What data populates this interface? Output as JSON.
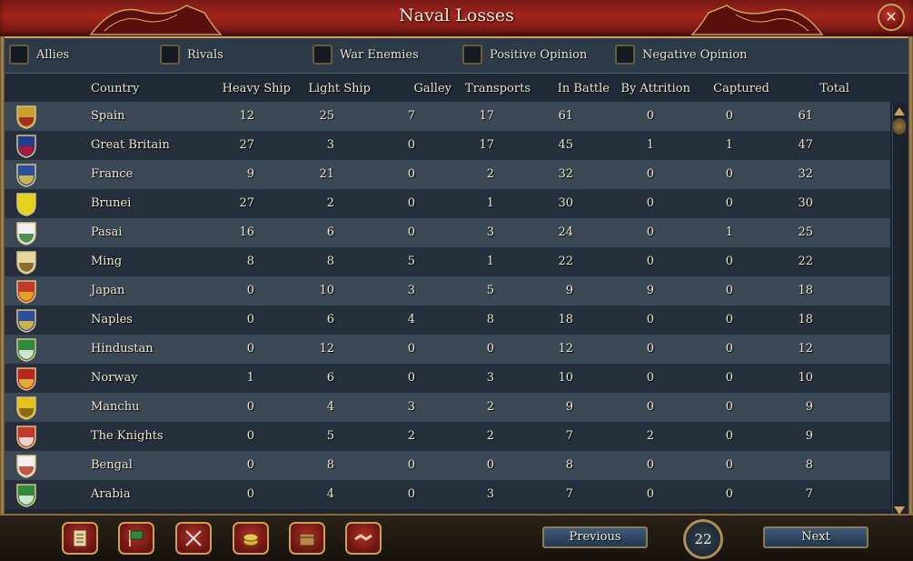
{
  "window": {
    "title": "Naval Losses",
    "close_icon": "close-icon"
  },
  "filters": [
    {
      "label": "Allies",
      "checked": false
    },
    {
      "label": "Rivals",
      "checked": false
    },
    {
      "label": "War Enemies",
      "checked": false
    },
    {
      "label": "Positive Opinion",
      "checked": false
    },
    {
      "label": "Negative Opinion",
      "checked": false
    }
  ],
  "table": {
    "columns": [
      "Country",
      "Heavy Ship",
      "Light Ship",
      "Galley",
      "Transports",
      "In Battle",
      "By Attrition",
      "Captured",
      "Total"
    ],
    "rows": [
      {
        "country": "Spain",
        "flag": "spain-flag-icon",
        "colors": [
          "#c8a12b",
          "#9b1c1c"
        ],
        "values": [
          "12",
          "25",
          "7",
          "17",
          "61",
          "0",
          "0",
          "61"
        ]
      },
      {
        "country": "Great Britain",
        "flag": "great-britain-flag-icon",
        "colors": [
          "#1f3f8c",
          "#c8102e"
        ],
        "values": [
          "27",
          "3",
          "0",
          "17",
          "45",
          "1",
          "1",
          "47"
        ]
      },
      {
        "country": "France",
        "flag": "france-flag-icon",
        "colors": [
          "#2d4fa0",
          "#e6c63d"
        ],
        "values": [
          "9",
          "21",
          "0",
          "2",
          "32",
          "0",
          "0",
          "32"
        ]
      },
      {
        "country": "Brunei",
        "flag": "brunei-flag-icon",
        "colors": [
          "#e3d21c",
          "#e3d21c"
        ],
        "values": [
          "27",
          "2",
          "0",
          "1",
          "30",
          "0",
          "0",
          "30"
        ]
      },
      {
        "country": "Pasai",
        "flag": "pasai-flag-icon",
        "colors": [
          "#f0f0f0",
          "#2e7d32"
        ],
        "values": [
          "16",
          "6",
          "0",
          "3",
          "24",
          "0",
          "1",
          "25"
        ]
      },
      {
        "country": "Ming",
        "flag": "ming-flag-icon",
        "colors": [
          "#e8d7a0",
          "#7a5a20"
        ],
        "values": [
          "8",
          "8",
          "5",
          "1",
          "22",
          "0",
          "0",
          "22"
        ]
      },
      {
        "country": "Japan",
        "flag": "japan-flag-icon",
        "colors": [
          "#c0392b",
          "#e6b422"
        ],
        "values": [
          "0",
          "10",
          "3",
          "5",
          "9",
          "9",
          "0",
          "18"
        ]
      },
      {
        "country": "Naples",
        "flag": "naples-flag-icon",
        "colors": [
          "#2d4fa0",
          "#e6c63d"
        ],
        "values": [
          "0",
          "6",
          "4",
          "8",
          "18",
          "0",
          "0",
          "18"
        ]
      },
      {
        "country": "Hindustan",
        "flag": "hindustan-flag-icon",
        "colors": [
          "#2e8b3a",
          "#f0f0f0"
        ],
        "values": [
          "0",
          "12",
          "0",
          "0",
          "12",
          "0",
          "0",
          "12"
        ]
      },
      {
        "country": "Norway",
        "flag": "norway-flag-icon",
        "colors": [
          "#b5281f",
          "#e6c63d"
        ],
        "values": [
          "1",
          "6",
          "0",
          "3",
          "10",
          "0",
          "0",
          "10"
        ]
      },
      {
        "country": "Manchu",
        "flag": "manchu-flag-icon",
        "colors": [
          "#e3c21c",
          "#7a5a10"
        ],
        "values": [
          "0",
          "4",
          "3",
          "2",
          "9",
          "0",
          "0",
          "9"
        ]
      },
      {
        "country": "The Knights",
        "flag": "the-knights-flag-icon",
        "colors": [
          "#c0392b",
          "#f0f0f0"
        ],
        "values": [
          "0",
          "5",
          "2",
          "2",
          "7",
          "2",
          "0",
          "9"
        ]
      },
      {
        "country": "Bengal",
        "flag": "bengal-flag-icon",
        "colors": [
          "#f0f0f0",
          "#c0392b"
        ],
        "values": [
          "0",
          "8",
          "0",
          "0",
          "8",
          "0",
          "0",
          "8"
        ]
      },
      {
        "country": "Arabia",
        "flag": "arabia-flag-icon",
        "colors": [
          "#2e8b3a",
          "#f0f0f0"
        ],
        "values": [
          "0",
          "4",
          "0",
          "3",
          "7",
          "0",
          "0",
          "7"
        ]
      }
    ]
  },
  "footer": {
    "tools": [
      "ledger-icon",
      "flag-icon",
      "crossed-swords-icon",
      "coins-icon",
      "trade-goods-icon",
      "handshake-icon"
    ],
    "previous_label": "Previous",
    "page": "22",
    "next_label": "Next"
  }
}
